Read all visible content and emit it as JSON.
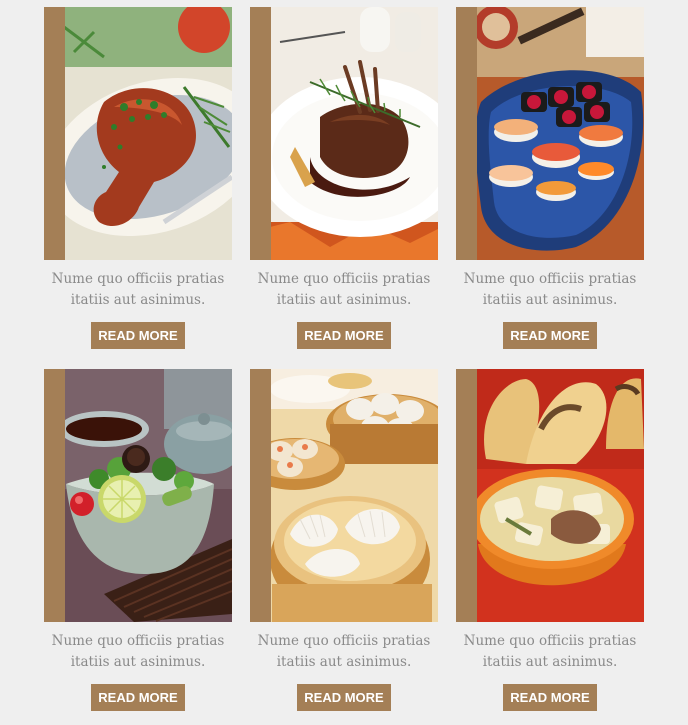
{
  "colors": {
    "background": "#efefef",
    "accent_bar": "#a47f56",
    "button_bg": "#a47f56",
    "button_text": "#ffffff",
    "caption_text": "#8a8a8a"
  },
  "cards": [
    {
      "photo": "roast-chicken-leg-photo",
      "caption_line1": "Nume quo officiis pratias",
      "caption_line2": "itatiis aut asinimus.",
      "button_label": "READ MORE"
    },
    {
      "photo": "lamb-rack-photo",
      "caption_line1": "Nume quo officiis pratias",
      "caption_line2": "itatiis aut asinimus.",
      "button_label": "READ MORE"
    },
    {
      "photo": "sushi-platter-photo",
      "caption_line1": "Nume quo officiis pratias",
      "caption_line2": "itatiis aut asinimus.",
      "button_label": "READ MORE"
    },
    {
      "photo": "salad-bowl-photo",
      "caption_line1": "Nume quo officiis pratias",
      "caption_line2": "itatiis aut asinimus.",
      "button_label": "READ MORE"
    },
    {
      "photo": "dim-sum-baskets-photo",
      "caption_line1": "Nume quo officiis pratias",
      "caption_line2": "itatiis aut asinimus.",
      "button_label": "READ MORE"
    },
    {
      "photo": "soup-bowl-photo",
      "caption_line1": "Nume quo officiis pratias",
      "caption_line2": "itatiis aut asinimus.",
      "button_label": "READ MORE"
    }
  ]
}
